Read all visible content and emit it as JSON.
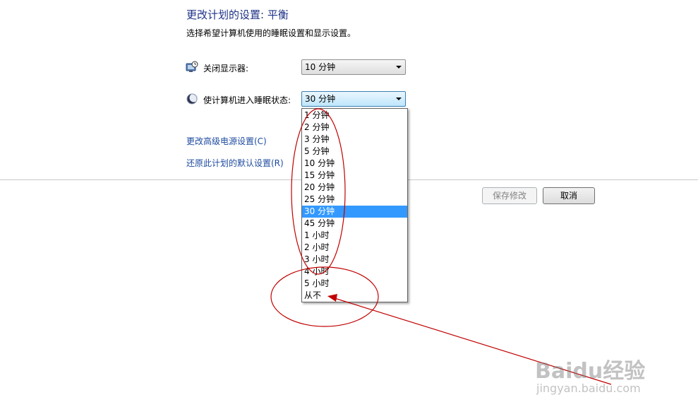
{
  "header": {
    "title": "更改计划的设置: 平衡",
    "subtitle": "选择希望计算机使用的睡眠设置和显示设置。"
  },
  "display_setting": {
    "icon": "monitor-clock-icon",
    "label": "关闭显示器:",
    "value": "10 分钟"
  },
  "sleep_setting": {
    "icon": "moon-icon",
    "label": "使计算机进入睡眠状态:",
    "value": "30 分钟"
  },
  "links": {
    "advanced": "更改高级电源设置(C)",
    "restore": "还原此计划的默认设置(R)"
  },
  "buttons": {
    "save": "保存修改",
    "cancel": "取消"
  },
  "dropdown": {
    "options": [
      "1 分钟",
      "2 分钟",
      "3 分钟",
      "5 分钟",
      "10 分钟",
      "15 分钟",
      "20 分钟",
      "25 分钟",
      "30 分钟",
      "45 分钟",
      "1 小时",
      "2 小时",
      "3 小时",
      "4 小时",
      "5 小时",
      "从不"
    ],
    "selected_index": 8
  },
  "annotation": {
    "color": "#c00000"
  },
  "watermark": {
    "brand": "Baidu经验",
    "url": "jingyan.baidu.com"
  }
}
